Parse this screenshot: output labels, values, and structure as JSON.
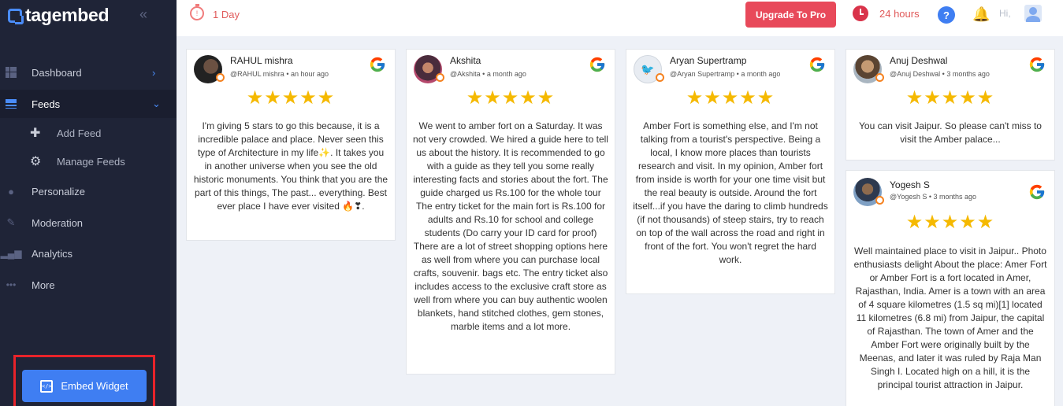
{
  "app": {
    "name": "tagembed"
  },
  "sidebar": {
    "items": [
      {
        "label": "Dashboard",
        "icon": "dashboard-icon"
      },
      {
        "label": "Feeds",
        "icon": "feeds-icon",
        "active": true
      },
      {
        "label": "Add Feed",
        "icon": "plus-icon"
      },
      {
        "label": "Manage Feeds",
        "icon": "gear-icon"
      },
      {
        "label": "Personalize",
        "icon": "person-icon"
      },
      {
        "label": "Moderation",
        "icon": "pen-icon"
      },
      {
        "label": "Analytics",
        "icon": "chart-icon"
      },
      {
        "label": "More",
        "icon": "more-icon"
      }
    ],
    "embed_label": "Embed Widget"
  },
  "topbar": {
    "day_text": "1 Day",
    "upgrade_label": "Upgrade To Pro",
    "hours_text": "24 hours",
    "help_label": "?",
    "greeting": "Hi,"
  },
  "colors": {
    "sidebar_bg": "#1f2437",
    "accent_blue": "#3f7ef2",
    "upgrade_red": "#e8495a",
    "star_gold": "#f5b900",
    "highlight_red": "#e8232a"
  },
  "reviews": [
    {
      "name": "RAHUL mishra",
      "handle": "@RAHUL mishra",
      "time": "an hour ago",
      "source": "google",
      "stars": "★★★★★",
      "text": "I'm giving 5 stars to go this because, it is a incredible palace and place. Never seen this type of Architecture in my life✨. It takes you in another universe when you see the old historic monuments. You think that you are the part of this things, The past... everything. Best ever place I have ever visited 🔥❣."
    },
    {
      "name": "Akshita",
      "handle": "@Akshita",
      "time": "a month ago",
      "source": "google",
      "stars": "★★★★★",
      "text": "We went to amber fort on a Saturday. It was not very crowded. We hired a guide here to tell us about the history. It is recommended to go with a guide as they tell you some really interesting facts and stories about the fort. The guide charged us Rs.100 for the whole tour The entry ticket for the main fort is Rs.100 for adults and Rs.10 for school and college students (Do carry your ID card for proof) There are a lot of street shopping options here as well from where you can purchase local crafts, souvenir. bags etc. The entry ticket also includes access to the exclusive craft store as well from where you can buy authentic woolen blankets, hand stitched clothes, gem stones, marble items and a lot more."
    },
    {
      "name": "Aryan Supertramp",
      "handle": "@Aryan Supertramp",
      "time": "a month ago",
      "source": "google",
      "stars": "★★★★★",
      "text": "Amber Fort is something else, and I'm not talking from a tourist's perspective. Being a local, I know more places than tourists research and visit. In my opinion, Amber fort from inside is worth for your one time visit but the real beauty is outside. Around the fort itself...if you have the daring to climb hundreds (if not thousands) of steep stairs, try to reach on top of the wall across the road and right in front of the fort. You won't regret the hard work."
    },
    {
      "name": "Anuj Deshwal",
      "handle": "@Anuj Deshwal",
      "time": "3 months ago",
      "source": "google",
      "stars": "★★★★★",
      "text": "You can visit Jaipur. So please can't miss to visit the Amber palace..."
    },
    {
      "name": "Yogesh S",
      "handle": "@Yogesh S",
      "time": "3 months ago",
      "source": "google",
      "stars": "★★★★★",
      "text": "Well maintained place to visit in Jaipur.. Photo enthusiasts delight About the place: Amer Fort or Amber Fort is a fort located in Amer, Rajasthan, India. Amer is a town with an area of 4 square kilometres (1.5 sq mi)[1] located 11 kilometres (6.8 mi) from Jaipur, the capital of Rajasthan. The town of Amer and the Amber Fort were originally built by the Meenas, and later it was ruled by Raja Man Singh I. Located high on a hill, it is the principal tourist attraction in Jaipur."
    }
  ]
}
